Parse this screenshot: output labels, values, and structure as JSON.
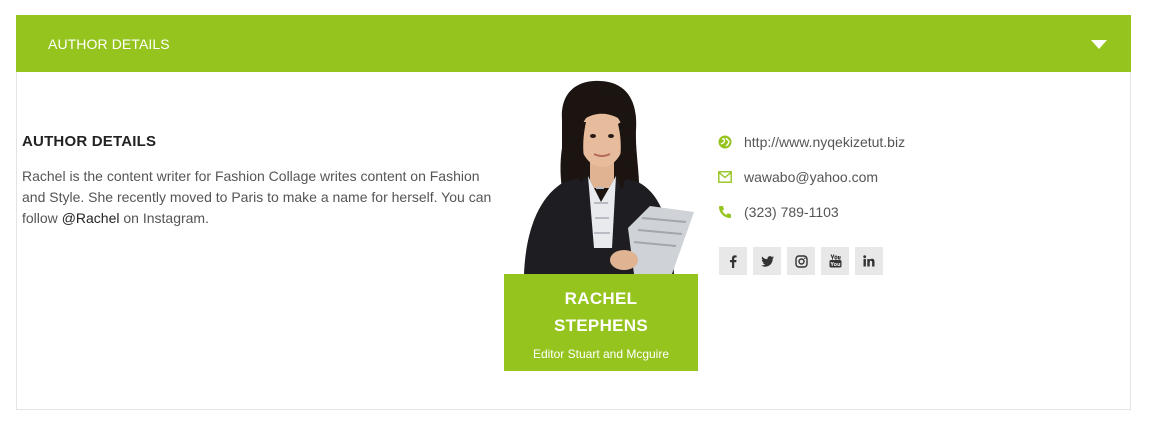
{
  "panel": {
    "header_title": "AUTHOR DETAILS",
    "accent_color": "#96c41f"
  },
  "bio": {
    "heading": "AUTHOR DETAILS",
    "text_before": "Rachel is the content writer for Fashion Collage writes content on Fashion and Style. She recently moved to Paris to make a name for herself. You can follow ",
    "handle": "@Rachel",
    "text_after": " on Instagram."
  },
  "author": {
    "name_line1": "RACHEL",
    "name_line2": "STEPHENS",
    "role": "Editor Stuart and Mcguire"
  },
  "contact": {
    "website": "http://www.nyqekizetut.biz",
    "email": "wawabo@yahoo.com",
    "phone": "(323) 789-1103"
  },
  "social": [
    {
      "icon": "facebook-icon",
      "glyph": "f"
    },
    {
      "icon": "twitter-icon",
      "glyph": "t"
    },
    {
      "icon": "instagram-icon",
      "glyph": "ig"
    },
    {
      "icon": "youtube-icon",
      "glyph": "yt"
    },
    {
      "icon": "linkedin-icon",
      "glyph": "in"
    }
  ]
}
